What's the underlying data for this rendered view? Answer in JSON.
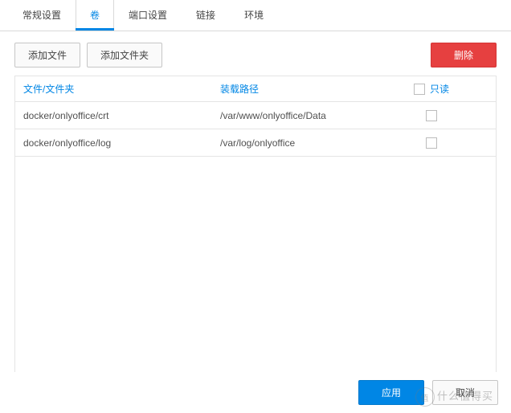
{
  "tabs": {
    "general": "常规设置",
    "volume": "卷",
    "port": "端口设置",
    "links": "链接",
    "env": "环境"
  },
  "toolbar": {
    "add_file": "添加文件",
    "add_folder": "添加文件夹",
    "delete": "删除"
  },
  "columns": {
    "file_folder": "文件/文件夹",
    "mount_path": "装载路径",
    "readonly": "只读"
  },
  "rows": [
    {
      "file": "docker/onlyoffice/crt",
      "mount": "/var/www/onlyoffice/Data"
    },
    {
      "file": "docker/onlyoffice/log",
      "mount": "/var/log/onlyoffice"
    }
  ],
  "footer": {
    "apply": "应用",
    "cancel": "取消"
  },
  "watermark": {
    "inner": "值",
    "text": "什么值得买"
  }
}
